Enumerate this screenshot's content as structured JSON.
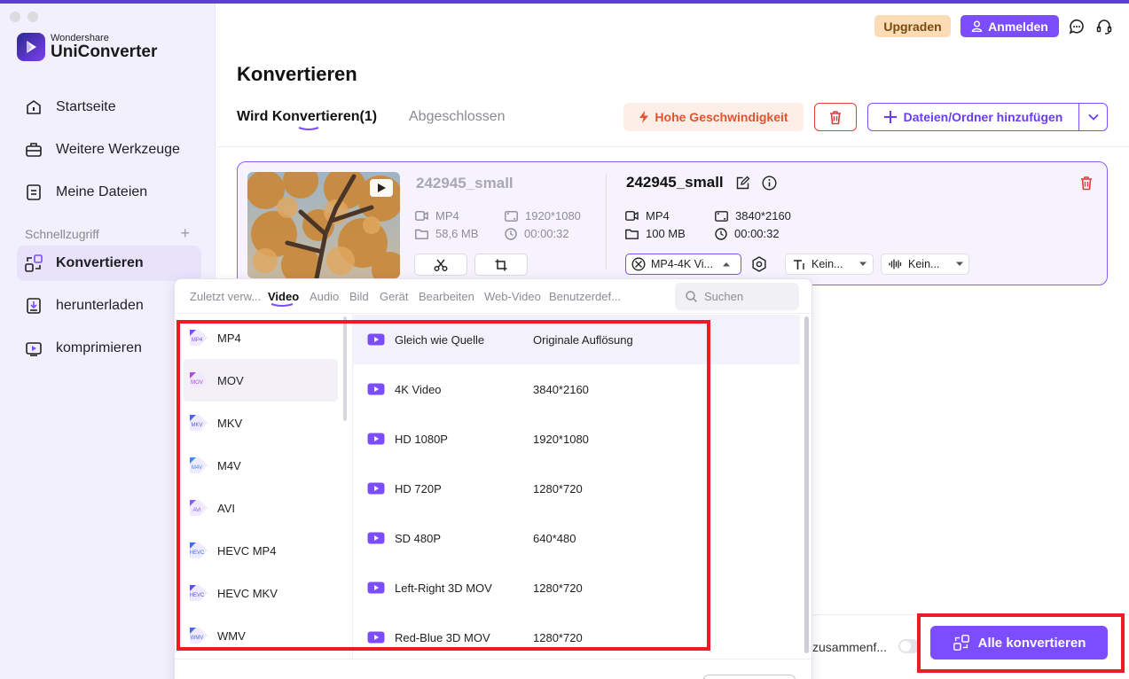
{
  "app": {
    "brand_top": "Wondershare",
    "brand_name": "UniConverter"
  },
  "header": {
    "upgrade_label": "Upgraden",
    "login_label": "Anmelden"
  },
  "sidebar": {
    "items": [
      {
        "label": "Startseite",
        "icon": "home-icon"
      },
      {
        "label": "Weitere Werkzeuge",
        "icon": "toolbox-icon"
      },
      {
        "label": "Meine Dateien",
        "icon": "files-icon"
      }
    ],
    "quick_access_label": "Schnellzugriff",
    "quick_items": [
      {
        "label": "Konvertieren",
        "icon": "convert-icon",
        "active": true
      },
      {
        "label": "herunterladen",
        "icon": "download-icon"
      },
      {
        "label": "komprimieren",
        "icon": "compress-icon"
      }
    ]
  },
  "main": {
    "title": "Konvertieren",
    "tabs": [
      {
        "label": "Wird Konvertieren(1)",
        "active": true
      },
      {
        "label": "Abgeschlossen",
        "active": false
      }
    ],
    "speed_label": "Hohe Geschwindigkeit",
    "add_label": "Dateien/Ordner hinzufügen"
  },
  "file": {
    "source": {
      "name": "242945_small",
      "format": "MP4",
      "resolution": "1920*1080",
      "size": "58,6 MB",
      "duration": "00:00:32"
    },
    "target": {
      "name": "242945_small",
      "format": "MP4",
      "resolution": "3840*2160",
      "size": "100 MB",
      "duration": "00:00:32"
    },
    "format_select": "MP4-4K Vi...",
    "subtitle_select": "Kein...",
    "audio_select": "Kein..."
  },
  "panel": {
    "tabs": [
      "Zuletzt verw...",
      "Video",
      "Audio",
      "Bild",
      "Gerät",
      "Bearbeiten",
      "Web-Video",
      "Benutzerdef..."
    ],
    "active_tab": "Video",
    "search_placeholder": "Suchen",
    "formats": [
      {
        "label": "MP4",
        "badge": "MP4"
      },
      {
        "label": "MOV",
        "badge": "MOV"
      },
      {
        "label": "MKV",
        "badge": "MKV"
      },
      {
        "label": "M4V",
        "badge": "M4V"
      },
      {
        "label": "AVI",
        "badge": "AVI"
      },
      {
        "label": "HEVC MP4",
        "badge": "HEVC"
      },
      {
        "label": "HEVC MKV",
        "badge": "HEVC"
      },
      {
        "label": "WMV",
        "badge": "WMV"
      }
    ],
    "presets": [
      {
        "name": "Gleich wie Quelle",
        "resolution": "Originale Auflösung"
      },
      {
        "name": "4K Video",
        "resolution": "3840*2160"
      },
      {
        "name": "HD 1080P",
        "resolution": "1920*1080"
      },
      {
        "name": "HD 720P",
        "resolution": "1280*720"
      },
      {
        "name": "SD 480P",
        "resolution": "640*480"
      },
      {
        "name": "Left-Right 3D MOV",
        "resolution": "1280*720"
      },
      {
        "name": "Red-Blue 3D MOV",
        "resolution": "1280*720"
      }
    ]
  },
  "bottom": {
    "merge_label": "zusammenf...",
    "convert_all_label": "Alle konvertieren"
  },
  "colors": {
    "accent": "#7c4dff",
    "highlight_box": "#ee1b24",
    "delete": "#e23b3b",
    "speed": "#e5532e"
  }
}
